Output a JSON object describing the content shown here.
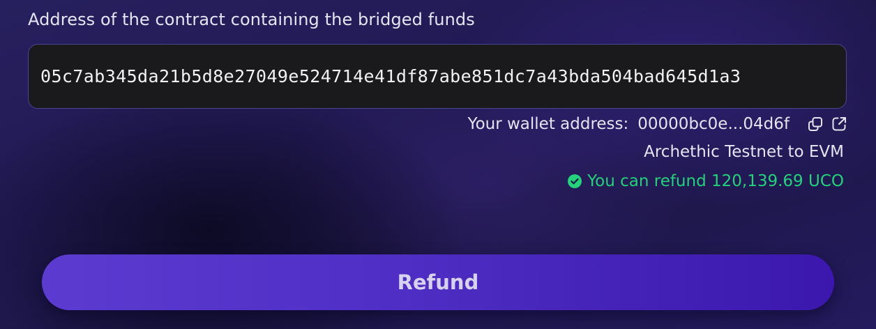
{
  "form": {
    "contract_label": "Address of the contract containing the bridged funds",
    "contract_address": "05c7ab345da21b5d8e27049e524714e41df87abe851dc7a43bda504bad645d1a3",
    "wallet_label": "Your wallet address:",
    "wallet_address": "00000bc0e...04d6f",
    "network": "Archethic Testnet to EVM",
    "refund_status": "You can refund 120,139.69 UCO",
    "refund_button": "Refund"
  },
  "icons": {
    "copy": "copy-icon",
    "external_link": "external-link-icon",
    "status": "check-circle-icon"
  },
  "colors": {
    "accent": "#5b3bd0",
    "success": "#23d27a",
    "input_background": "#1a1a1c",
    "input_border": "#4a4690"
  }
}
